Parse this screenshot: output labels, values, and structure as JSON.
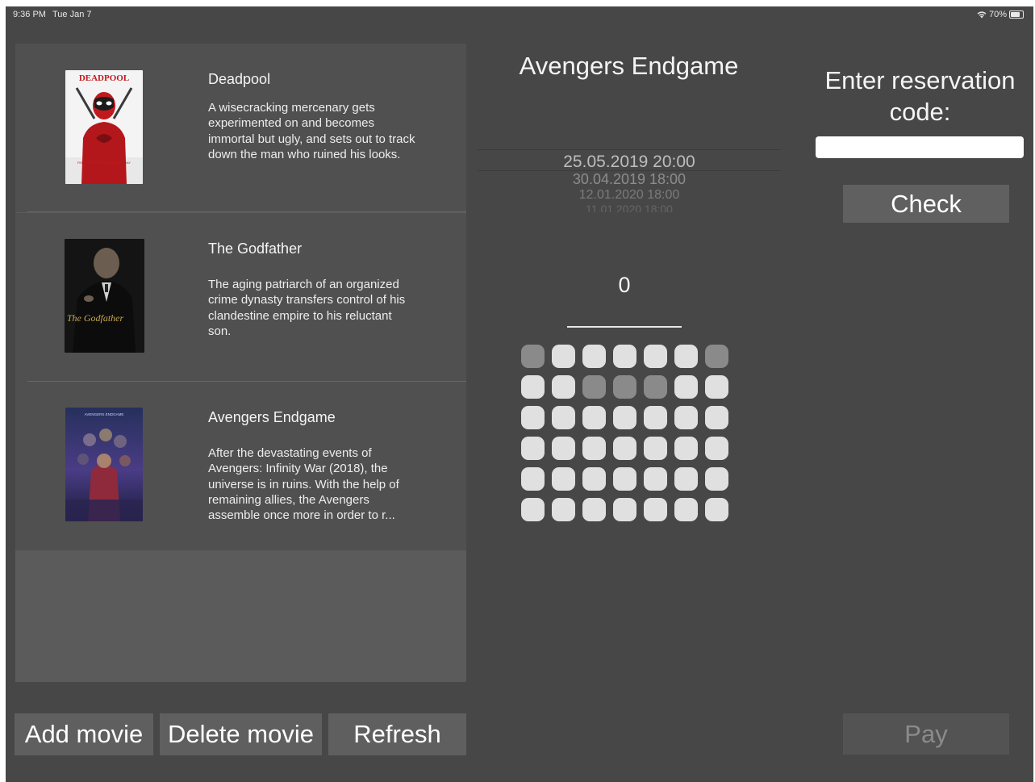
{
  "status_bar": {
    "time": "9:36 PM",
    "date": "Tue Jan 7",
    "battery_text": "70%",
    "battery_level": 0.7
  },
  "movies": [
    {
      "title": "Deadpool",
      "description": "A wisecracking mercenary gets experimented on and becomes immortal but ugly, and sets out to track down the man who ruined his looks.",
      "poster_text": "DEADPOOL",
      "poster_tagline": "FEEL THE LOVE VALENTINE'S DAY"
    },
    {
      "title": "The Godfather",
      "description": "The aging patriarch of an organized crime dynasty transfers control of his clandestine empire to his reluctant son.",
      "poster_text": "The Godfather"
    },
    {
      "title": "Avengers Endgame",
      "description": "After the devastating events of Avengers: Infinity War (2018), the universe is in ruins. With the help of remaining allies, the Avengers assemble once more in order to r...",
      "poster_text": "AVENGERS ENDGAME"
    }
  ],
  "buttons": {
    "add": "Add movie",
    "delete": "Delete movie",
    "refresh": "Refresh",
    "check": "Check",
    "pay": "Pay"
  },
  "selected_movie": {
    "title": "Avengers Endgame"
  },
  "showtimes": [
    "25.05.2019 20:00",
    "30.04.2019 18:00",
    "12.01.2020 18:00",
    "11.01.2020 18:00"
  ],
  "seat_count": "0",
  "seat_grid": {
    "rows": 6,
    "columns": 7,
    "taken": [
      [
        0,
        0
      ],
      [
        0,
        6
      ],
      [
        1,
        2
      ],
      [
        1,
        3
      ],
      [
        1,
        4
      ]
    ]
  },
  "reservation": {
    "label": "Enter reservation code:",
    "value": "",
    "placeholder": ""
  },
  "colors": {
    "background": "#474747",
    "list_row": "#505050",
    "button": "#5f5f5f",
    "seat_free": "#e0e0e0",
    "seat_taken": "#8a8a8a"
  }
}
